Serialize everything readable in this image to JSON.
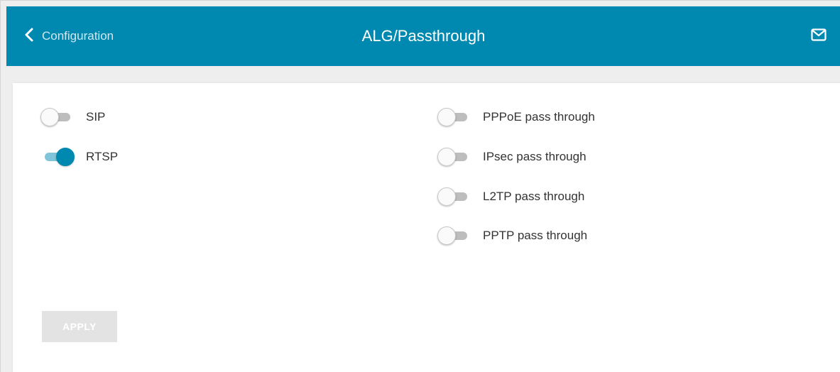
{
  "header": {
    "back_label": "Configuration",
    "title": "ALG/Passthrough",
    "back_icon": "chevron-left-icon",
    "mail_icon": "mail-icon"
  },
  "colors": {
    "header_bg": "#0089b0",
    "toggle_on": "#0089b0",
    "page_bg": "#eeeeee",
    "button_disabled": "#e3e3e3"
  },
  "left_toggles": [
    {
      "label": "SIP",
      "on": false
    },
    {
      "label": "RTSP",
      "on": true
    }
  ],
  "right_toggles": [
    {
      "label": "PPPoE pass through",
      "on": false
    },
    {
      "label": "IPsec pass through",
      "on": false
    },
    {
      "label": "L2TP pass through",
      "on": false
    },
    {
      "label": "PPTP pass through",
      "on": false
    }
  ],
  "apply_button": {
    "label": "APPLY",
    "enabled": false
  }
}
